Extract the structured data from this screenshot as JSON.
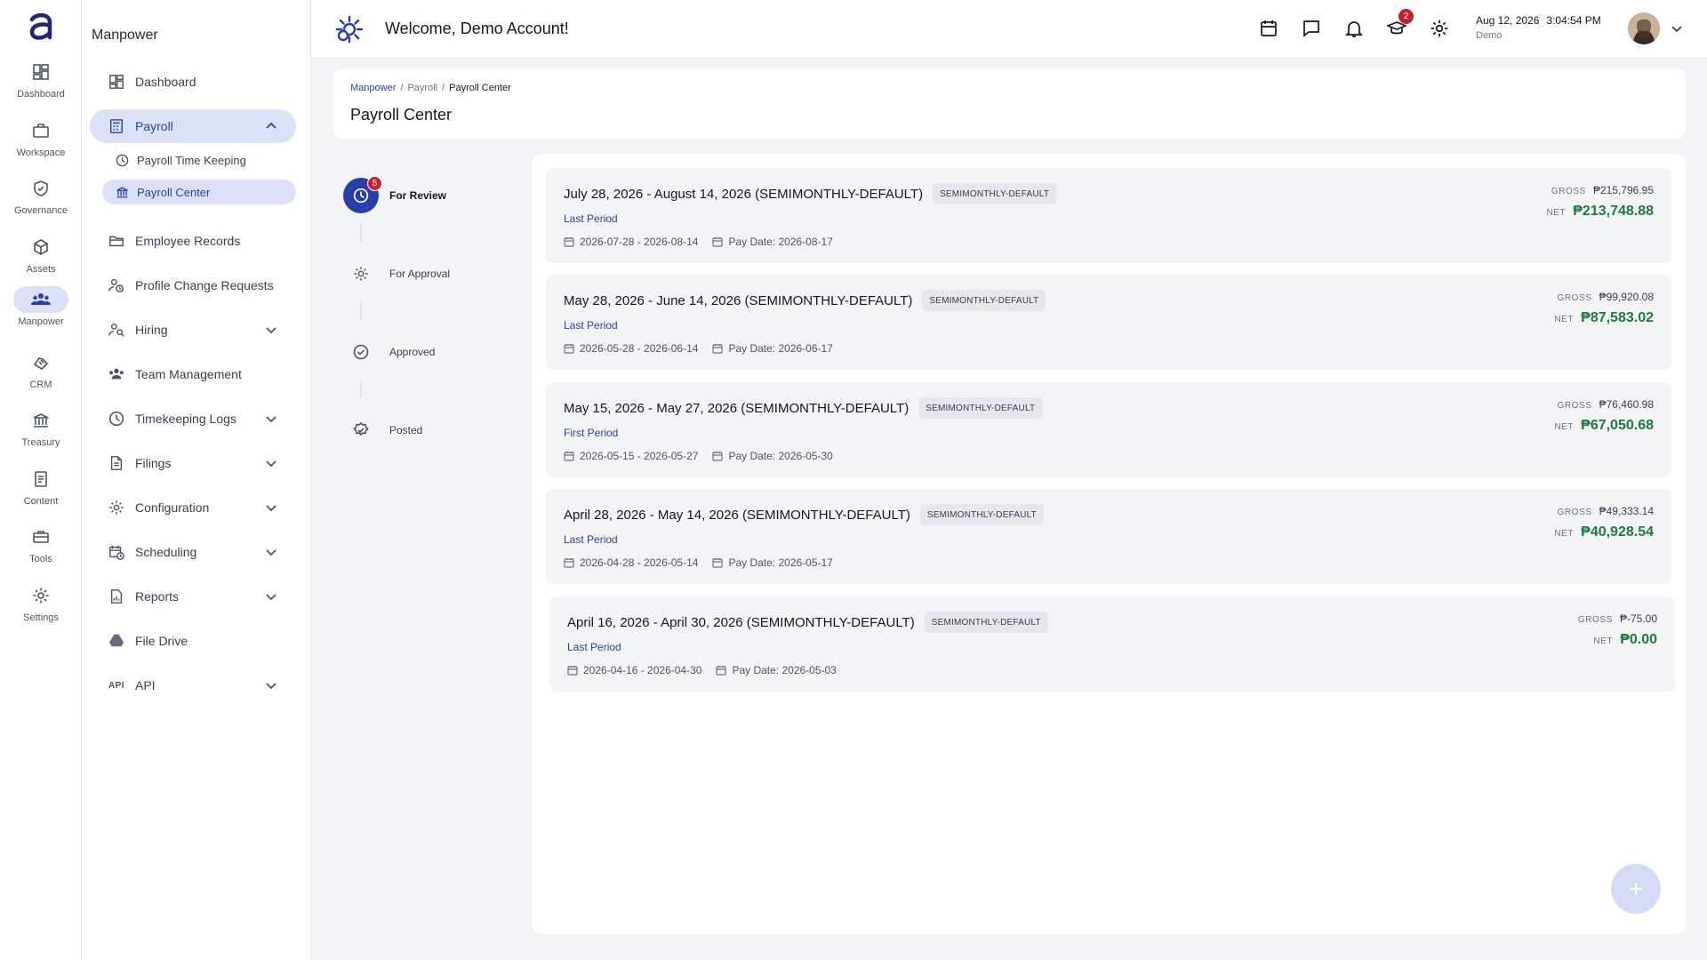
{
  "rail": {
    "items": [
      {
        "label": "Dashboard",
        "icon": "dashboard-icon"
      },
      {
        "label": "Workspace",
        "icon": "briefcase-icon"
      },
      {
        "label": "Governance",
        "icon": "shield-check-icon"
      },
      {
        "label": "Assets",
        "icon": "cube-icon"
      },
      {
        "label": "Manpower",
        "icon": "people-icon"
      },
      {
        "label": "CRM",
        "icon": "handshake-icon"
      },
      {
        "label": "Treasury",
        "icon": "bank-icon"
      },
      {
        "label": "Content",
        "icon": "documents-icon"
      },
      {
        "label": "Tools",
        "icon": "toolbox-icon"
      },
      {
        "label": "Settings",
        "icon": "gear-icon"
      }
    ],
    "active": "Manpower"
  },
  "sidebar": {
    "title": "Manpower",
    "items": [
      {
        "label": "Dashboard"
      },
      {
        "label": "Payroll"
      },
      {
        "label": "Payroll Time Keeping"
      },
      {
        "label": "Payroll Center"
      },
      {
        "label": "Employee Records"
      },
      {
        "label": "Profile Change Requests"
      },
      {
        "label": "Hiring"
      },
      {
        "label": "Team Management"
      },
      {
        "label": "Timekeeping Logs"
      },
      {
        "label": "Filings"
      },
      {
        "label": "Configuration"
      },
      {
        "label": "Scheduling"
      },
      {
        "label": "Reports"
      },
      {
        "label": "File Drive"
      },
      {
        "label": "API"
      }
    ],
    "api_glyph": "API"
  },
  "topbar": {
    "welcome": "Welcome, Demo Account!",
    "learning_badge": "2",
    "date": "Aug 12, 2026",
    "time": "3:04:54 PM",
    "user": "Demo"
  },
  "breadcrumb": {
    "root": "Manpower",
    "mid": "Payroll",
    "current": "Payroll Center",
    "sep": "/"
  },
  "page_title": "Payroll Center",
  "steps": [
    {
      "label": "For Review",
      "badge": "5"
    },
    {
      "label": "For Approval"
    },
    {
      "label": "Approved"
    },
    {
      "label": "Posted"
    }
  ],
  "labels": {
    "gross": "GROSS",
    "net": "NET",
    "pay_date_prefix": "Pay Date: "
  },
  "payrolls": [
    {
      "title": "July 28, 2026 - August 14, 2026 (SEMIMONTHLY-DEFAULT)",
      "tag": "SEMIMONTHLY-DEFAULT",
      "period": "Last Period",
      "range": "2026-07-28 - 2026-08-14",
      "pay_date": "Pay Date: 2026-08-17",
      "gross": "₱215,796.95",
      "net": "₱213,748.88"
    },
    {
      "title": "May 28, 2026 - June 14, 2026 (SEMIMONTHLY-DEFAULT)",
      "tag": "SEMIMONTHLY-DEFAULT",
      "period": "Last Period",
      "range": "2026-05-28 - 2026-06-14",
      "pay_date": "Pay Date: 2026-06-17",
      "gross": "₱99,920.08",
      "net": "₱87,583.02"
    },
    {
      "title": "May 15, 2026 - May 27, 2026 (SEMIMONTHLY-DEFAULT)",
      "tag": "SEMIMONTHLY-DEFAULT",
      "period": "First Period",
      "range": "2026-05-15 - 2026-05-27",
      "pay_date": "Pay Date: 2026-05-30",
      "gross": "₱76,460.98",
      "net": "₱67,050.68"
    },
    {
      "title": "April 28, 2026 - May 14, 2026 (SEMIMONTHLY-DEFAULT)",
      "tag": "SEMIMONTHLY-DEFAULT",
      "period": "Last Period",
      "range": "2026-04-28 - 2026-05-14",
      "pay_date": "Pay Date: 2026-05-17",
      "gross": "₱49,333.14",
      "net": "₱40,928.54"
    },
    {
      "title": "April 16, 2026 - April 30, 2026 (SEMIMONTHLY-DEFAULT)",
      "tag": "SEMIMONTHLY-DEFAULT",
      "period": "Last Period",
      "range": "2026-04-16 - 2026-04-30",
      "pay_date": "Pay Date: 2026-05-03",
      "gross": "₱-75.00",
      "net": "₱0.00"
    }
  ],
  "colors": {
    "accent": "#2b3ea8",
    "accent_soft": "#dbe2f7",
    "net_green": "#1f7a3d",
    "badge_red": "#c8202f"
  }
}
